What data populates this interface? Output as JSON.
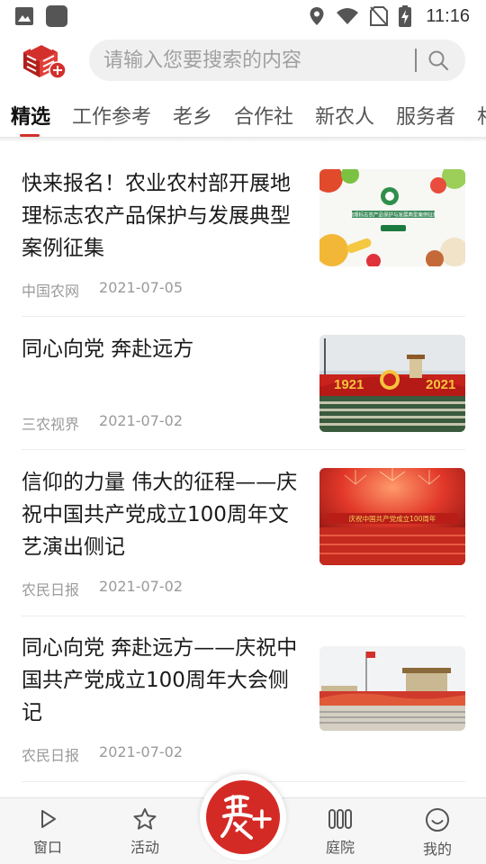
{
  "status_bar": {
    "time": "11:16",
    "icons": [
      "image-icon",
      "app-square-icon",
      "location-icon",
      "wifi-icon",
      "no-sim-icon",
      "battery-charging-icon"
    ]
  },
  "header": {
    "logo": "app-logo-add",
    "search": {
      "placeholder": "请输入您要搜索的内容",
      "value": "",
      "icon": "search-icon"
    }
  },
  "tabs": [
    {
      "label": "精选",
      "active": true
    },
    {
      "label": "工作参考",
      "active": false
    },
    {
      "label": "老乡",
      "active": false
    },
    {
      "label": "合作社",
      "active": false
    },
    {
      "label": "新农人",
      "active": false
    },
    {
      "label": "服务者",
      "active": false
    },
    {
      "label": "村",
      "active": false
    }
  ],
  "articles": [
    {
      "title": "快来报名！农业农村部开展地理标志农产品保护与发展典型案例征集",
      "source": "中国农网",
      "date": "2021-07-05",
      "thumb_text": "地理标志农产品保护与发展典型案例征集"
    },
    {
      "title": "同心向党 奔赴远方",
      "source": "三农视界",
      "date": "2021-07-02",
      "thumb_text": [
        "1921",
        "2021"
      ]
    },
    {
      "title": "信仰的力量 伟大的征程——庆祝中国共产党成立100周年文艺演出侧记",
      "source": "农民日报",
      "date": "2021-07-02",
      "thumb_text": "庆祝中国共产党成立100周年"
    },
    {
      "title": "同心向党 奔赴远方——庆祝中国共产党成立100周年大会侧记",
      "source": "农民日报",
      "date": "2021-07-02",
      "thumb_text": ""
    }
  ],
  "bottom_nav": [
    {
      "label": "窗口",
      "icon": "play-icon"
    },
    {
      "label": "活动",
      "icon": "star-icon"
    },
    {
      "label": "",
      "icon": "nong-plus-center-icon"
    },
    {
      "label": "庭院",
      "icon": "columns-icon"
    },
    {
      "label": "我的",
      "icon": "smile-icon"
    }
  ],
  "colors": {
    "accent": "#d3302b",
    "text_primary": "#1a1a1a",
    "text_meta": "#9a9a9a",
    "search_bg": "#f0f0f0",
    "nav_bg": "#f6f6f6"
  }
}
